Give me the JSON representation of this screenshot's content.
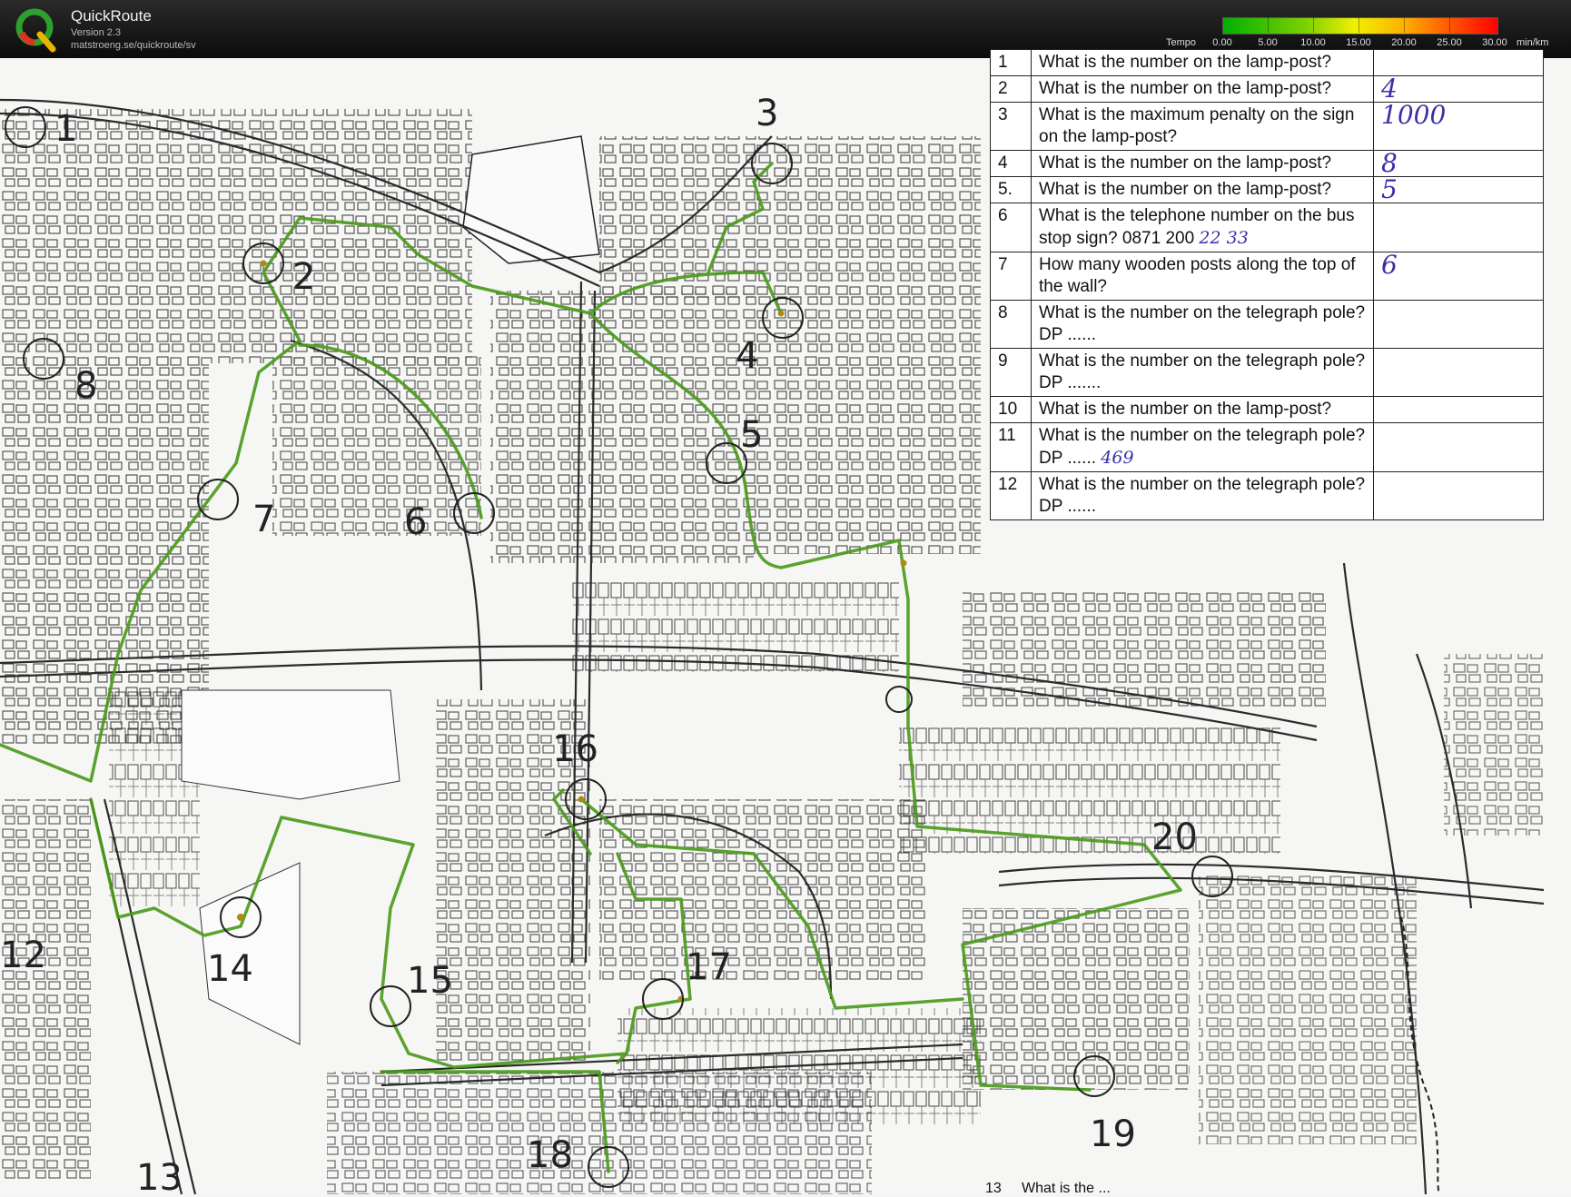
{
  "app": {
    "name": "QuickRoute",
    "version": "Version 2.3",
    "url": "matstroeng.se/quickroute/sv"
  },
  "legend": {
    "label": "Tempo",
    "ticks": [
      "0.00",
      "5.00",
      "10.00",
      "15.00",
      "20.00",
      "25.00",
      "30.00"
    ],
    "unit": "min/km",
    "colors": [
      "#00b000",
      "#7dd000",
      "#f0f000",
      "#ffb000",
      "#ff5a00",
      "#ff0000"
    ]
  },
  "questions": [
    {
      "num": "1",
      "text": "What is the number on the lamp-post?",
      "answer": ""
    },
    {
      "num": "2",
      "text": "What is the number on the lamp-post?",
      "answer": "4"
    },
    {
      "num": "3",
      "text": "What is the maximum penalty on the sign on the lamp-post?",
      "answer": "1000"
    },
    {
      "num": "4",
      "text": "What is the number on the lamp-post?",
      "answer": "8"
    },
    {
      "num": "5.",
      "text": "What is the number on the lamp-post?",
      "answer": "5"
    },
    {
      "num": "6",
      "text": "What is the telephone number on the bus stop sign? 0871 200",
      "answer": "",
      "inline_answer": "22 33"
    },
    {
      "num": "7",
      "text": "How many wooden posts along the top of the wall?",
      "answer": "6"
    },
    {
      "num": "8",
      "text": "What is the number on the telegraph pole? DP ......",
      "answer": ""
    },
    {
      "num": "9",
      "text": "What is the number on the telegraph pole? DP .......",
      "answer": ""
    },
    {
      "num": "10",
      "text": "What is the number on the lamp-post?",
      "answer": ""
    },
    {
      "num": "11",
      "text": "What is the number on the telegraph pole? DP ......",
      "answer": "",
      "inline_answer": "469"
    },
    {
      "num": "12",
      "text": "What is the number on the telegraph pole? DP ......",
      "answer": ""
    }
  ],
  "bottom_question": {
    "num": "13",
    "text": "What is the ..."
  },
  "controls": [
    {
      "label": "1"
    },
    {
      "label": "2"
    },
    {
      "label": "3"
    },
    {
      "label": "4"
    },
    {
      "label": "5"
    },
    {
      "label": "6"
    },
    {
      "label": "7"
    },
    {
      "label": "8"
    },
    {
      "label": "12"
    },
    {
      "label": "13"
    },
    {
      "label": "14"
    },
    {
      "label": "15"
    },
    {
      "label": "16"
    },
    {
      "label": "17"
    },
    {
      "label": "18"
    },
    {
      "label": "19"
    },
    {
      "label": "20"
    }
  ],
  "colors": {
    "route": "#4a9a1a",
    "route_slow": "#b08a10",
    "map_ink": "#2b2b2b"
  }
}
